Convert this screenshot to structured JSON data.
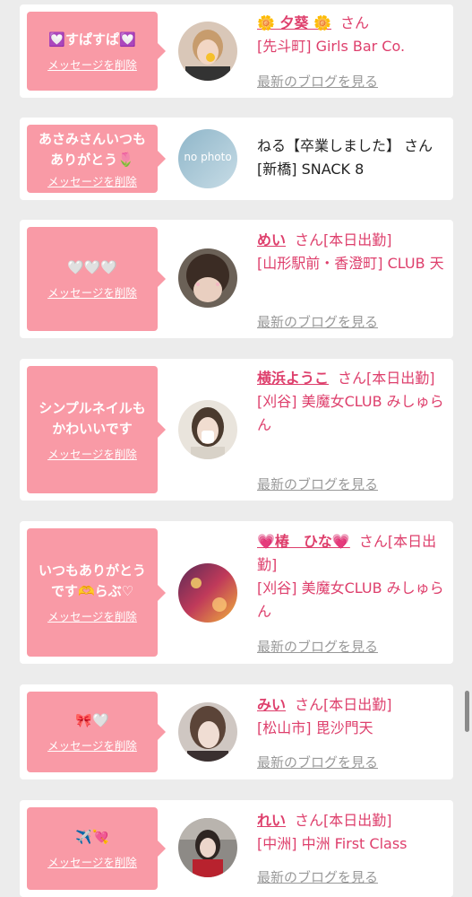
{
  "colors": {
    "background": "#ececec",
    "card": "#ffffff",
    "bubble": "#f99aa6",
    "accent": "#de3f6c",
    "muted": "#999999"
  },
  "entries": [
    {
      "message": "💟すぱすぱ💟",
      "delete_label": "メッセージを削除",
      "name": "🌼 夕葵 🌼",
      "honorific": "さん",
      "status": "",
      "shop": "[先斗町] Girls Bar Co.",
      "blog_label": "最新のブログを見る",
      "name_linked": true,
      "avatar_icon": "cast-photo-avatar"
    },
    {
      "message": "あさみさんいつもありがとう🌷",
      "delete_label": "メッセージを削除",
      "name": "ねる【卒業しました】",
      "honorific": "さん",
      "status": "",
      "shop": "[新橋] SNACK 8",
      "blog_label": "",
      "name_linked": false,
      "avatar_icon": "no-photo-avatar",
      "avatar_text": "no photo"
    },
    {
      "message": "🤍🤍🤍",
      "delete_label": "メッセージを削除",
      "name": "めい",
      "honorific": "さん",
      "status": "[本日出勤]",
      "shop": "[山形駅前・香澄町] CLUB 天",
      "blog_label": "最新のブログを見る",
      "name_linked": true,
      "avatar_icon": "cast-photo-avatar"
    },
    {
      "message": "シンプルネイルもかわいいです",
      "delete_label": "メッセージを削除",
      "name": "横浜ようこ",
      "honorific": "さん",
      "status": "[本日出勤]",
      "shop": "[刈谷] 美魔女CLUB みしゅらん",
      "blog_label": "最新のブログを見る",
      "name_linked": true,
      "avatar_icon": "cast-photo-avatar"
    },
    {
      "message": "いつもありがとうです🫶らぶ♡",
      "delete_label": "メッセージを削除",
      "name": "💗椿　ひな💗",
      "honorific": "さん",
      "status": "[本日出勤]",
      "shop": "[刈谷] 美魔女CLUB みしゅらん",
      "blog_label": "最新のブログを見る",
      "name_linked": true,
      "avatar_icon": "cast-photo-avatar"
    },
    {
      "message": "🎀🤍",
      "delete_label": "メッセージを削除",
      "name": "みい",
      "honorific": "さん",
      "status": "[本日出勤]",
      "shop": "[松山市] 毘沙門天",
      "blog_label": "最新のブログを見る",
      "name_linked": true,
      "avatar_icon": "cast-photo-avatar"
    },
    {
      "message": "✈️💘",
      "delete_label": "メッセージを削除",
      "name": "れい",
      "honorific": "さん",
      "status": "[本日出勤]",
      "shop": "[中洲] 中洲 First Class",
      "blog_label": "最新のブログを見る",
      "name_linked": true,
      "avatar_icon": "cast-photo-avatar"
    }
  ]
}
